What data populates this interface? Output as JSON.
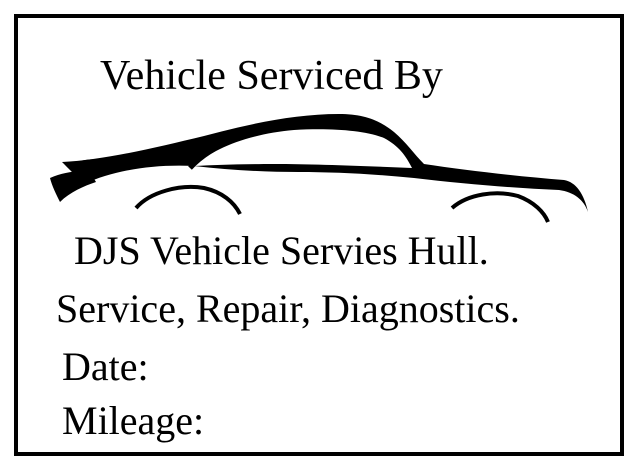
{
  "card": {
    "heading": "Vehicle Serviced By",
    "company": "DJS Vehicle Servies Hull.",
    "services": "Service, Repair, Diagnostics.",
    "date_label": "Date:",
    "mileage_label": "Mileage:"
  },
  "colors": {
    "ink": "#000000",
    "background": "#ffffff"
  },
  "icons": {
    "car": "car-silhouette-icon"
  }
}
